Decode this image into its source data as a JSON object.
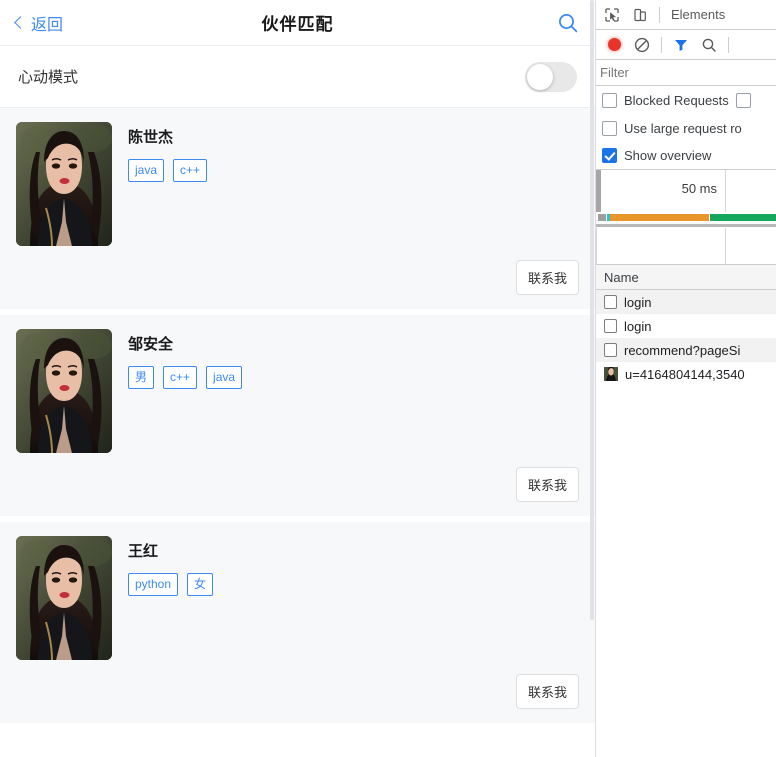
{
  "app": {
    "nav": {
      "back_label": "返回",
      "title": "伙伴匹配",
      "search_icon": "search-icon",
      "back_icon": "chevron-left-icon"
    },
    "heart_mode": {
      "label": "心动模式",
      "toggle_state": "off"
    },
    "contact_button_label": "联系我",
    "users": [
      {
        "name": "陈世杰",
        "tags": [
          "java",
          "c++"
        ]
      },
      {
        "name": "邹安全",
        "tags": [
          "男",
          "c++",
          "java"
        ]
      },
      {
        "name": "王红",
        "tags": [
          "python",
          "女"
        ]
      }
    ],
    "colors": {
      "accent": "#3d8bf2",
      "card_bg": "#f7f8fa",
      "tag_border": "#3d8bf2"
    }
  },
  "devtools": {
    "tabbar": {
      "inspect_icon": "inspect-cursor-icon",
      "device_icon": "device-toolbar-icon",
      "active_tab": "Elements"
    },
    "toolbar": {
      "record_icon": "record-button-icon",
      "clear_icon": "clear-icon",
      "filter_icon": "filter-funnel-icon",
      "search_icon": "search-icon"
    },
    "filter": {
      "placeholder": "Filter",
      "value": ""
    },
    "options": [
      {
        "label": "Blocked Requests",
        "checked": false
      },
      {
        "label": "Use large request ro",
        "checked": false
      },
      {
        "label": "Show overview",
        "checked": true
      }
    ],
    "overview": {
      "tick_label": "50 ms",
      "bar_colors": {
        "gray": "#9e9e9e",
        "cyan": "#25c3d6",
        "orange": "#e8952a",
        "green": "#16a75c"
      }
    },
    "table": {
      "column_header": "Name",
      "rows": [
        {
          "name": "login",
          "icon": "document-icon"
        },
        {
          "name": "login",
          "icon": "document-icon"
        },
        {
          "name": "recommend?pageSi",
          "icon": "document-icon"
        },
        {
          "name": "u=4164804144,3540",
          "icon": "image-thumbnail-icon"
        }
      ]
    }
  }
}
